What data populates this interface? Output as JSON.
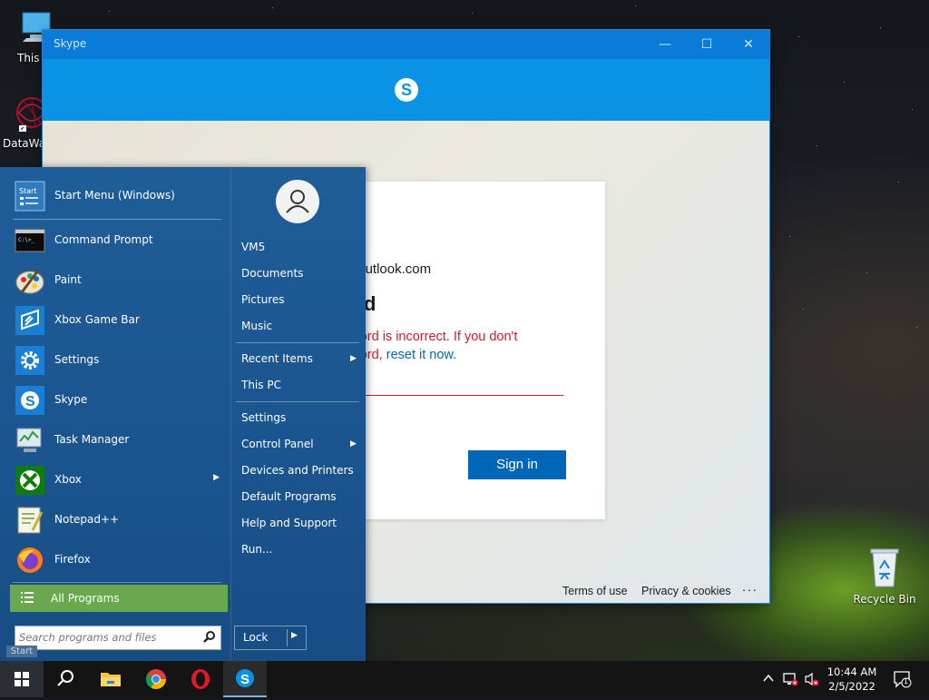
{
  "desktop": {
    "icons": [
      {
        "label": "This PC"
      },
      {
        "label": "DataWag"
      },
      {
        "label": "Recycle Bin"
      }
    ]
  },
  "skype": {
    "title": "Skype",
    "logo_letter": "S",
    "email_suffix": "@outlook.com",
    "heading_fragment": "ord",
    "error_line1": "sword is incorrect. If you don't",
    "error_line2_prefix": "sword, ",
    "error_link": "reset it now.",
    "signin_label": "Sign in",
    "footer": {
      "terms": "Terms of use",
      "privacy": "Privacy & cookies",
      "more": "..."
    }
  },
  "start_menu": {
    "pinned": [
      {
        "label": "Start Menu (Windows)",
        "icon": "start-menu-icon"
      },
      {
        "label": "Command Prompt",
        "icon": "command-prompt-icon"
      },
      {
        "label": "Paint",
        "icon": "paint-icon"
      },
      {
        "label": "Xbox Game Bar",
        "icon": "xbox-game-bar-icon"
      },
      {
        "label": "Settings",
        "icon": "settings-gear-icon"
      },
      {
        "label": "Skype",
        "icon": "skype-icon"
      },
      {
        "label": "Task Manager",
        "icon": "task-manager-icon"
      },
      {
        "label": "Xbox",
        "icon": "xbox-icon",
        "has_submenu": true
      },
      {
        "label": "Notepad++",
        "icon": "notepadpp-icon"
      },
      {
        "label": "Firefox",
        "icon": "firefox-icon"
      }
    ],
    "all_programs": "All Programs",
    "search_placeholder": "Search programs and files",
    "right": [
      {
        "label": "VM5"
      },
      {
        "label": "Documents"
      },
      {
        "label": "Pictures"
      },
      {
        "label": "Music"
      },
      {
        "label": "Recent Items",
        "has_submenu": true
      },
      {
        "label": "This PC"
      },
      {
        "label": "Settings"
      },
      {
        "label": "Control Panel",
        "has_submenu": true
      },
      {
        "label": "Devices and Printers"
      },
      {
        "label": "Default Programs"
      },
      {
        "label": "Help and Support"
      },
      {
        "label": "Run..."
      }
    ],
    "lock_label": "Lock",
    "start_tooltip": "Start"
  },
  "taskbar": {
    "apps": [
      "start-icon",
      "search-icon",
      "file-explorer-icon",
      "chrome-icon",
      "opera-icon",
      "skype-icon"
    ],
    "time": "10:44 AM",
    "date": "2/5/2022",
    "notification_count": "1"
  },
  "colors": {
    "skype_blue": "#0a92e4",
    "start_menu_blue": "#1f5d99",
    "all_programs_green": "#6aa84f",
    "error_red": "#d01830",
    "signin_blue": "#0067b8"
  }
}
